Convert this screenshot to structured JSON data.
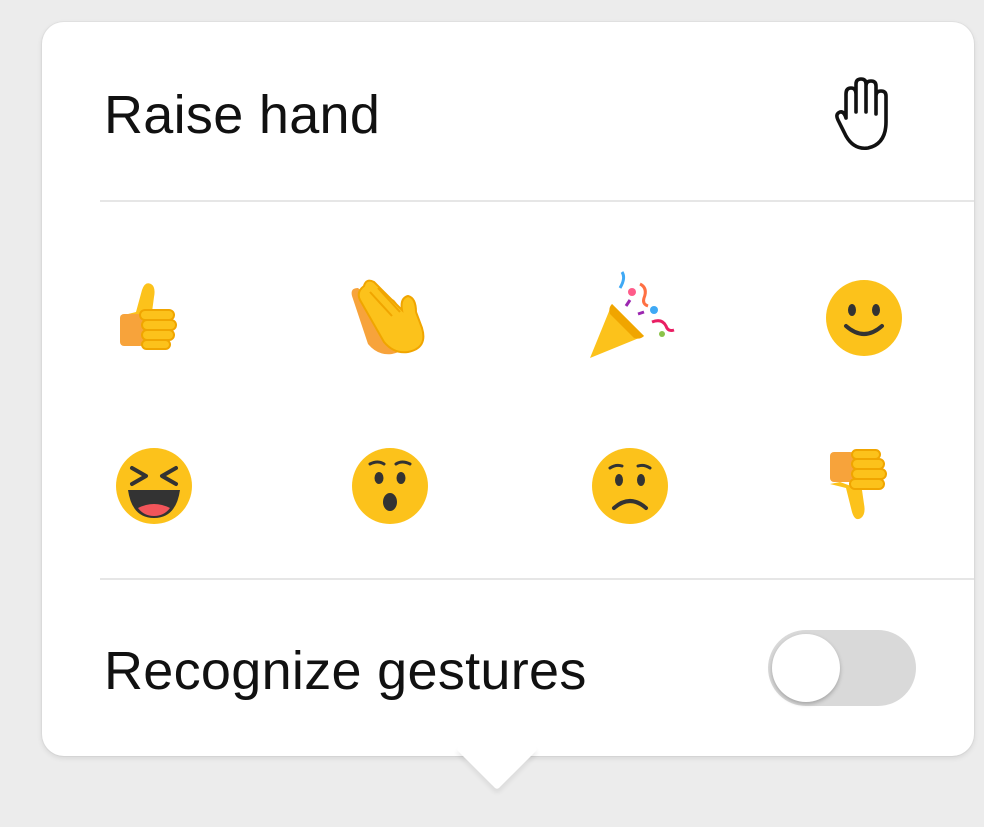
{
  "raise_hand": {
    "label": "Raise hand",
    "icon": "raise-hand-icon"
  },
  "reactions": [
    {
      "name": "thumbs-up",
      "icon": "thumbs-up-icon"
    },
    {
      "name": "clap",
      "icon": "clapping-hands-icon"
    },
    {
      "name": "party",
      "icon": "party-popper-icon"
    },
    {
      "name": "smile",
      "icon": "smiling-face-icon"
    },
    {
      "name": "laugh",
      "icon": "laughing-face-icon"
    },
    {
      "name": "surprised",
      "icon": "surprised-face-icon"
    },
    {
      "name": "sad",
      "icon": "sad-face-icon"
    },
    {
      "name": "thumbs-down",
      "icon": "thumbs-down-icon"
    }
  ],
  "gestures": {
    "label": "Recognize gestures",
    "toggle_on": false
  },
  "colors": {
    "emoji_yellow": "#fcc21b",
    "emoji_outline": "#f0a500",
    "toggle_off": "#d9d9d9"
  }
}
